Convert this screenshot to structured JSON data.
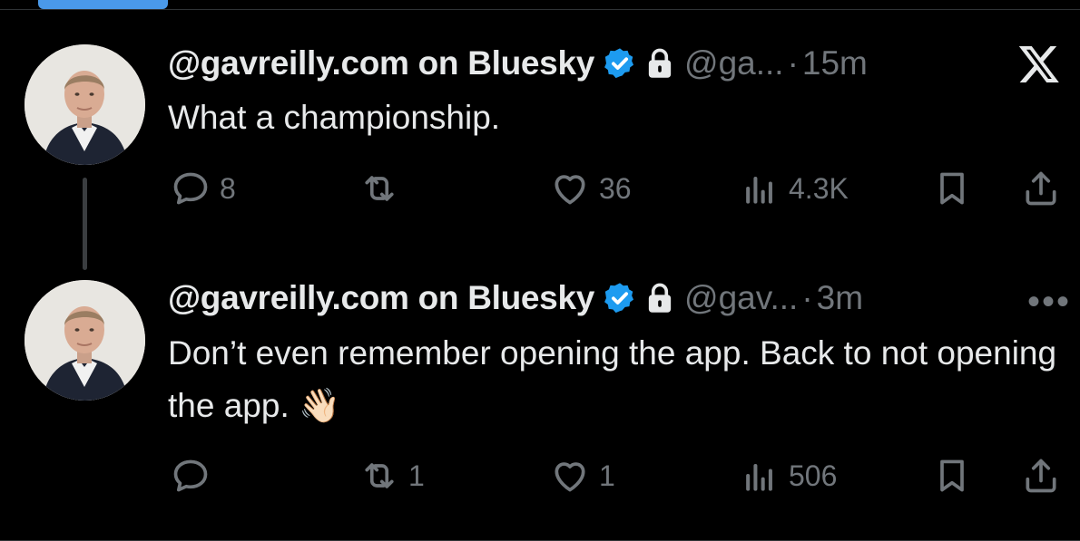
{
  "colors": {
    "verified": "#1d9bf0",
    "muted": "#71767b",
    "text": "#e7e9ea",
    "background": "#000000"
  },
  "tweets": [
    {
      "author_name": "@gavreilly.com on Bluesky",
      "handle": "@ga...",
      "separator": "·",
      "time": "15m",
      "text": "What a championship.",
      "replies": "8",
      "reposts": "",
      "likes": "36",
      "views": "4.3K",
      "corner_icon": "x-logo-icon"
    },
    {
      "author_name": "@gavreilly.com on Bluesky",
      "handle": "@gav...",
      "separator": "·",
      "time": "3m",
      "text": "Don’t even remember opening the app. Back to not opening the app. 👋🏻",
      "replies": "",
      "reposts": "1",
      "likes": "1",
      "views": "506",
      "corner_icon": "more-options-icon",
      "more_label": "•••"
    }
  ]
}
